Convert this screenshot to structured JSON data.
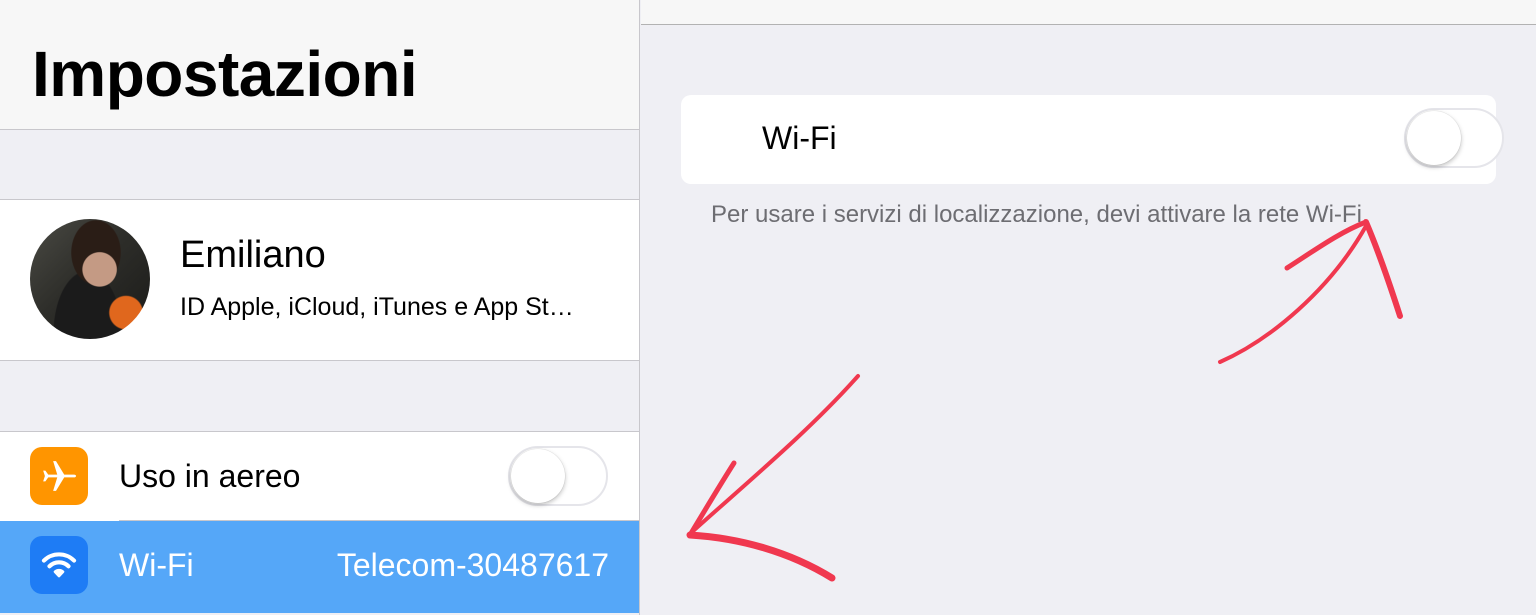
{
  "sidebar": {
    "title": "Impostazioni",
    "profile": {
      "name": "Emiliano",
      "subtitle": "ID Apple, iCloud, iTunes e App St…"
    },
    "rows": [
      {
        "label": "Uso in aereo",
        "icon": "airplane-icon",
        "icon_color": "#ff9500",
        "toggle_on": false
      },
      {
        "label": "Wi-Fi",
        "value": "Telecom-30487617",
        "icon": "wifi-icon",
        "icon_color": "#1e7cf5",
        "selected": true
      }
    ]
  },
  "detail": {
    "wifi_label": "Wi-Fi",
    "wifi_toggle_on": false,
    "footer_note": "Per usare i servizi di localizzazione, devi attivare la rete Wi-Fi."
  },
  "colors": {
    "selected_row": "#55a7f8",
    "annotation": "#f0384f",
    "background": "#efeff4"
  }
}
